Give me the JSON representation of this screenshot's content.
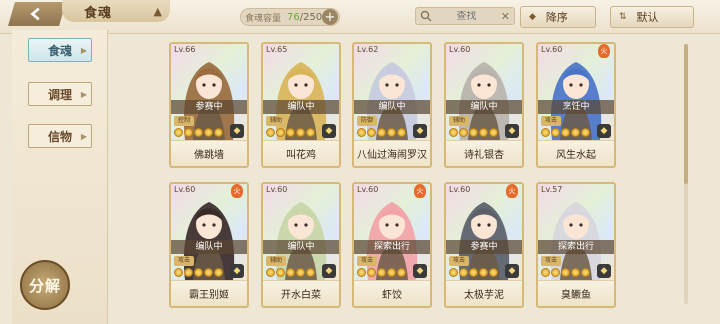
{
  "topbar": {
    "title": "食魂",
    "capacity_label": "食魂容量",
    "capacity_current": "76",
    "capacity_total": "/250",
    "search_placeholder": "查找",
    "sort_desc_label": "降序",
    "sort_default_label": "默认"
  },
  "sidebar": {
    "tabs": [
      {
        "label": "食魂",
        "active": true
      },
      {
        "label": "调理",
        "active": false
      },
      {
        "label": "信物",
        "active": false
      }
    ],
    "decompose_label": "分解"
  },
  "cards": [
    {
      "level": "Lv.66",
      "status": "参赛中",
      "name": "佛跳墙",
      "role": "控制",
      "hair": "#9a6b3f",
      "flame": false,
      "stars_lit": 5
    },
    {
      "level": "Lv.65",
      "status": "编队中",
      "name": "叫花鸡",
      "role": "辅助",
      "hair": "#d9b55a",
      "flame": false,
      "stars_lit": 5
    },
    {
      "level": "Lv.62",
      "status": "编队中",
      "name": "八仙过海闹罗汉",
      "role": "防御",
      "hair": "#c7cbe0",
      "flame": false,
      "stars_lit": 5
    },
    {
      "level": "Lv.60",
      "status": "编队中",
      "name": "诗礼银杏",
      "role": "辅助",
      "hair": "#b9b3ad",
      "flame": false,
      "stars_lit": 5
    },
    {
      "level": "Lv.60",
      "status": "烹饪中",
      "name": "风生水起",
      "role": "攻击",
      "hair": "#4a74c8",
      "flame": true,
      "stars_lit": 5
    },
    {
      "level": "Lv.60",
      "status": "编队中",
      "name": "霸王别姬",
      "role": "攻击",
      "hair": "#3a2a2a",
      "flame": true,
      "stars_lit": 5
    },
    {
      "level": "Lv.60",
      "status": "编队中",
      "name": "开水白菜",
      "role": "辅助",
      "hair": "#c9d6a8",
      "flame": false,
      "stars_lit": 5
    },
    {
      "level": "Lv.60",
      "status": "探索出行",
      "name": "虾饺",
      "role": "攻击",
      "hair": "#f2a3a8",
      "flame": true,
      "stars_lit": 5
    },
    {
      "level": "Lv.60",
      "status": "参赛中",
      "name": "太极芋泥",
      "role": "攻击",
      "hair": "#5a5f6a",
      "flame": true,
      "stars_lit": 5
    },
    {
      "level": "Lv.57",
      "status": "探索出行",
      "name": "臭鳜鱼",
      "role": "攻击",
      "hair": "#d7d7dd",
      "flame": false,
      "stars_lit": 5
    }
  ]
}
